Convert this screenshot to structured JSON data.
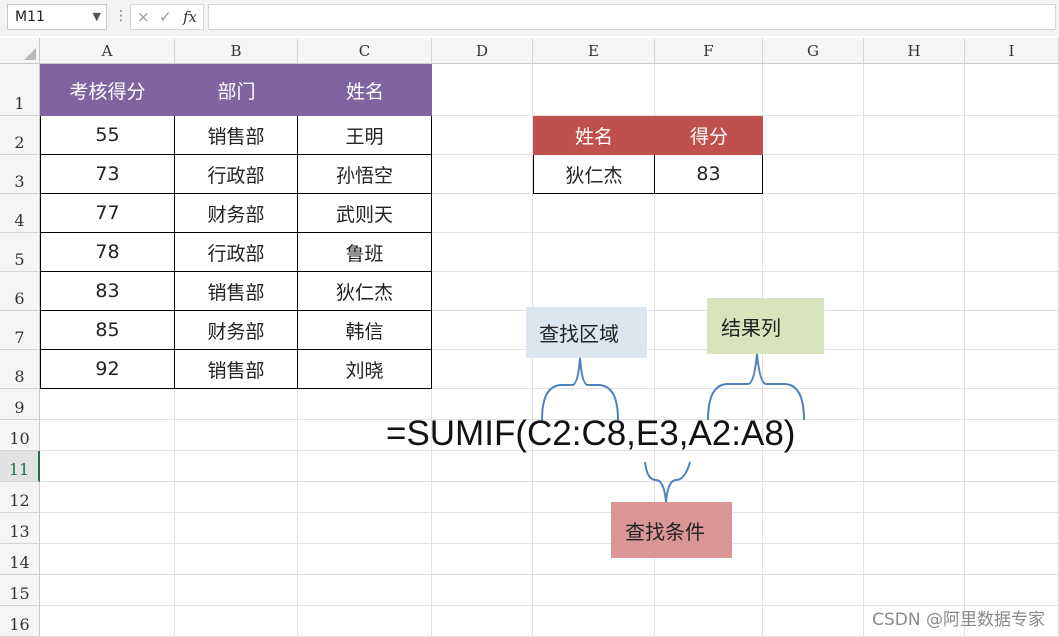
{
  "name_box": "M11",
  "formula_bar": {
    "cancel_icon": "×",
    "enter_icon": "✓",
    "fx_label": "fx",
    "value": ""
  },
  "columns": [
    "A",
    "B",
    "C",
    "D",
    "E",
    "F",
    "G",
    "H",
    "I"
  ],
  "rows": [
    "1",
    "2",
    "3",
    "4",
    "5",
    "6",
    "7",
    "8",
    "9",
    "10",
    "11",
    "12",
    "13",
    "14",
    "15",
    "16"
  ],
  "active_row": "11",
  "table1": {
    "headers": [
      "考核得分",
      "部门",
      "姓名"
    ],
    "header_color": "#8064a2",
    "rows": [
      [
        "55",
        "销售部",
        "王明"
      ],
      [
        "73",
        "行政部",
        "孙悟空"
      ],
      [
        "77",
        "财务部",
        "武则天"
      ],
      [
        "78",
        "行政部",
        "鲁班"
      ],
      [
        "83",
        "销售部",
        "狄仁杰"
      ],
      [
        "85",
        "财务部",
        "韩信"
      ],
      [
        "92",
        "销售部",
        "刘晓"
      ]
    ]
  },
  "table2": {
    "headers": [
      "姓名",
      "得分"
    ],
    "header_color": "#c0504d",
    "row": [
      "狄仁杰",
      "83"
    ]
  },
  "annotations": {
    "formula": "=SUMIF(C2:C8,E3,A2:A8)",
    "search_range": {
      "label": "查找区域",
      "color": "#dce6f1"
    },
    "result_column": {
      "label": "结果列",
      "color": "#d8e4bc"
    },
    "criteria": {
      "label": "查找条件",
      "color": "#da9694"
    }
  },
  "watermark": "CSDN @阿里数据专家"
}
